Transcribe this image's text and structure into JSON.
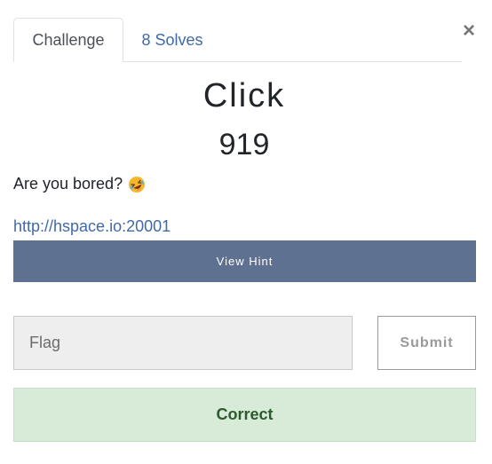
{
  "tabs": [
    {
      "label": "Challenge",
      "active": true
    },
    {
      "label": "8 Solves",
      "active": false
    }
  ],
  "close_label": "×",
  "challenge": {
    "name": "Click",
    "points": "919",
    "description": "Are you bored?",
    "description_emoji": "rolling-on-floor-laughing-emoji",
    "link": "http://hspace.io:20001"
  },
  "hint_button_label": "View Hint",
  "flag_input": {
    "placeholder": "Flag",
    "value": ""
  },
  "submit_label": "Submit",
  "result_message": "Correct",
  "colors": {
    "link": "#3f6aa6",
    "hint_button_bg": "#5e7190",
    "result_bg": "#d8ebd9",
    "result_text": "#2e5a2f"
  }
}
